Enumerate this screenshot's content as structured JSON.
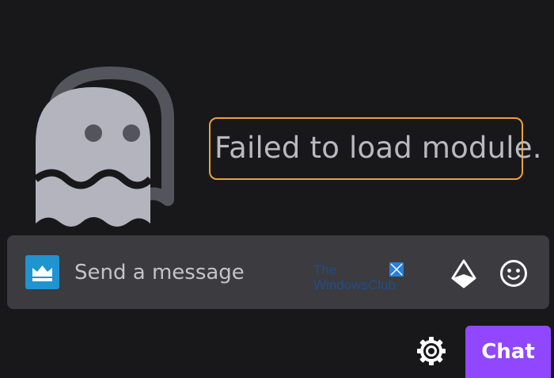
{
  "error": {
    "message": "Failed to load module."
  },
  "chat_input": {
    "placeholder": "Send a message",
    "badge_icon": "crown-icon",
    "bits_icon": "bits-icon",
    "emote_icon": "smiley-icon"
  },
  "watermark": {
    "line1": "The",
    "line2": "WindowsClub"
  },
  "footer": {
    "settings_icon": "gear-icon",
    "chat_button_label": "Chat"
  },
  "colors": {
    "background": "#18181b",
    "input_bg": "#3b3b40",
    "highlight_border": "#e8a23a",
    "chat_button": "#9147ff",
    "badge": "#1f94d1",
    "ghost": "#b4b4be"
  }
}
